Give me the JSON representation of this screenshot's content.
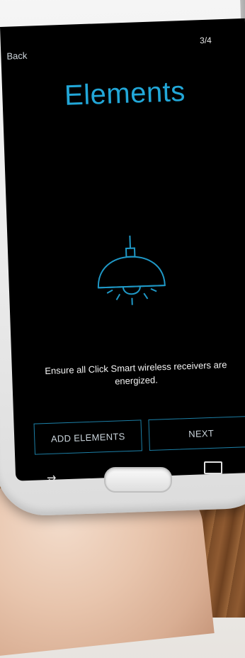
{
  "header": {
    "back_label": "Back",
    "page_indicator": "3/4"
  },
  "main": {
    "title": "Elements",
    "icon": "ceiling-lamp-icon",
    "message": "Ensure all Click Smart wireless receivers are energized."
  },
  "actions": {
    "add_elements_label": "ADD ELEMENTS",
    "next_label": "NEXT"
  },
  "colors": {
    "accent": "#22a7d8",
    "button_border": "#1c7fa6",
    "screen_bg": "#000000"
  }
}
